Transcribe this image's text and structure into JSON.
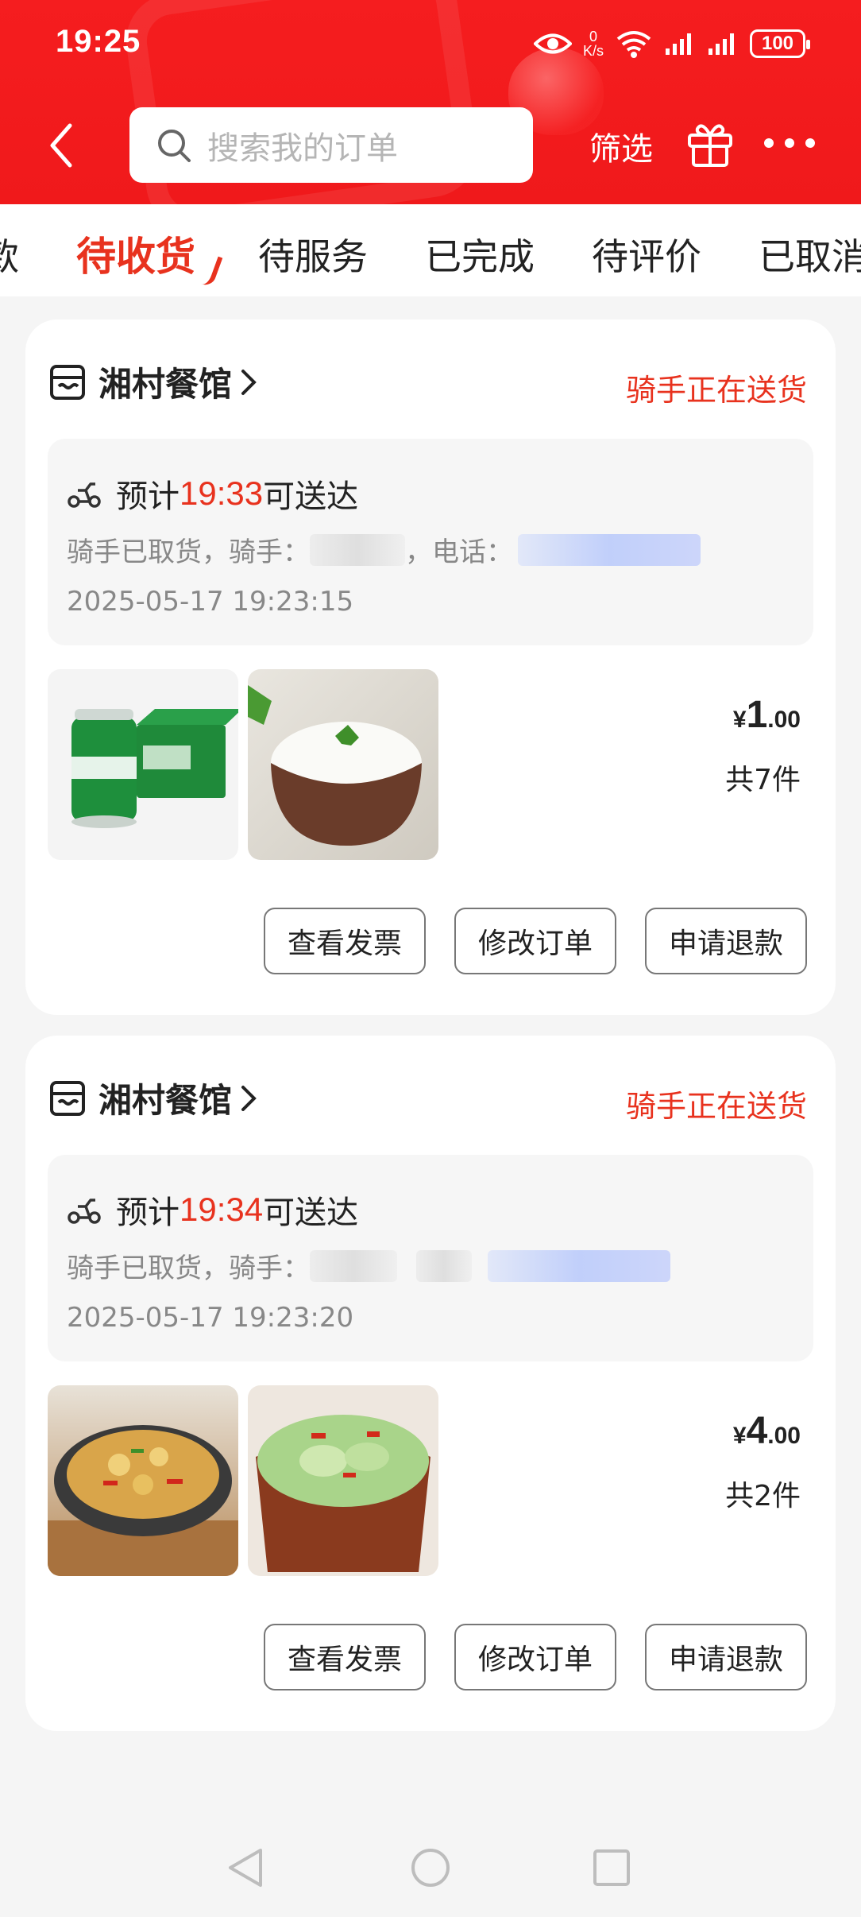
{
  "status_bar": {
    "time": "19:25",
    "net_speed_value": "0",
    "net_speed_unit": "K/s",
    "battery": "100"
  },
  "header": {
    "search_placeholder": "搜索我的订单",
    "filter_label": "筛选"
  },
  "tabs": [
    {
      "label": "款",
      "active": false
    },
    {
      "label": "待收货",
      "active": true
    },
    {
      "label": "待服务",
      "active": false
    },
    {
      "label": "已完成",
      "active": false
    },
    {
      "label": "待评价",
      "active": false
    },
    {
      "label": "已取消",
      "active": false
    }
  ],
  "orders": [
    {
      "store_name": "湘村餐馆",
      "status": "骑手正在送货",
      "eta_prefix": "预计",
      "eta_time": "19:33",
      "eta_suffix": "可送达",
      "rider_text": "骑手已取货，骑手：",
      "rider_phone_label": "，电话：",
      "order_time": "2025-05-17 19:23:15",
      "price_symbol": "¥",
      "price_int": "1",
      "price_dec": ".00",
      "item_count": "共7件",
      "items": [
        "雪花啤酒",
        "米饭"
      ],
      "buttons": [
        "查看发票",
        "修改订单",
        "申请退款"
      ]
    },
    {
      "store_name": "湘村餐馆",
      "status": "骑手正在送货",
      "eta_prefix": "预计",
      "eta_time": "19:34",
      "eta_suffix": "可送达",
      "rider_text": "骑手已取货，骑手：",
      "rider_phone_label": "",
      "order_time": "2025-05-17 19:23:20",
      "price_symbol": "¥",
      "price_int": "4",
      "price_dec": ".00",
      "item_count": "共2件",
      "items": [
        "干锅土豆片",
        "手撕包菜"
      ],
      "buttons": [
        "查看发票",
        "修改订单",
        "申请退款"
      ]
    }
  ],
  "colors": {
    "brand_red": "#f51d1f",
    "accent_red": "#e8321e"
  }
}
